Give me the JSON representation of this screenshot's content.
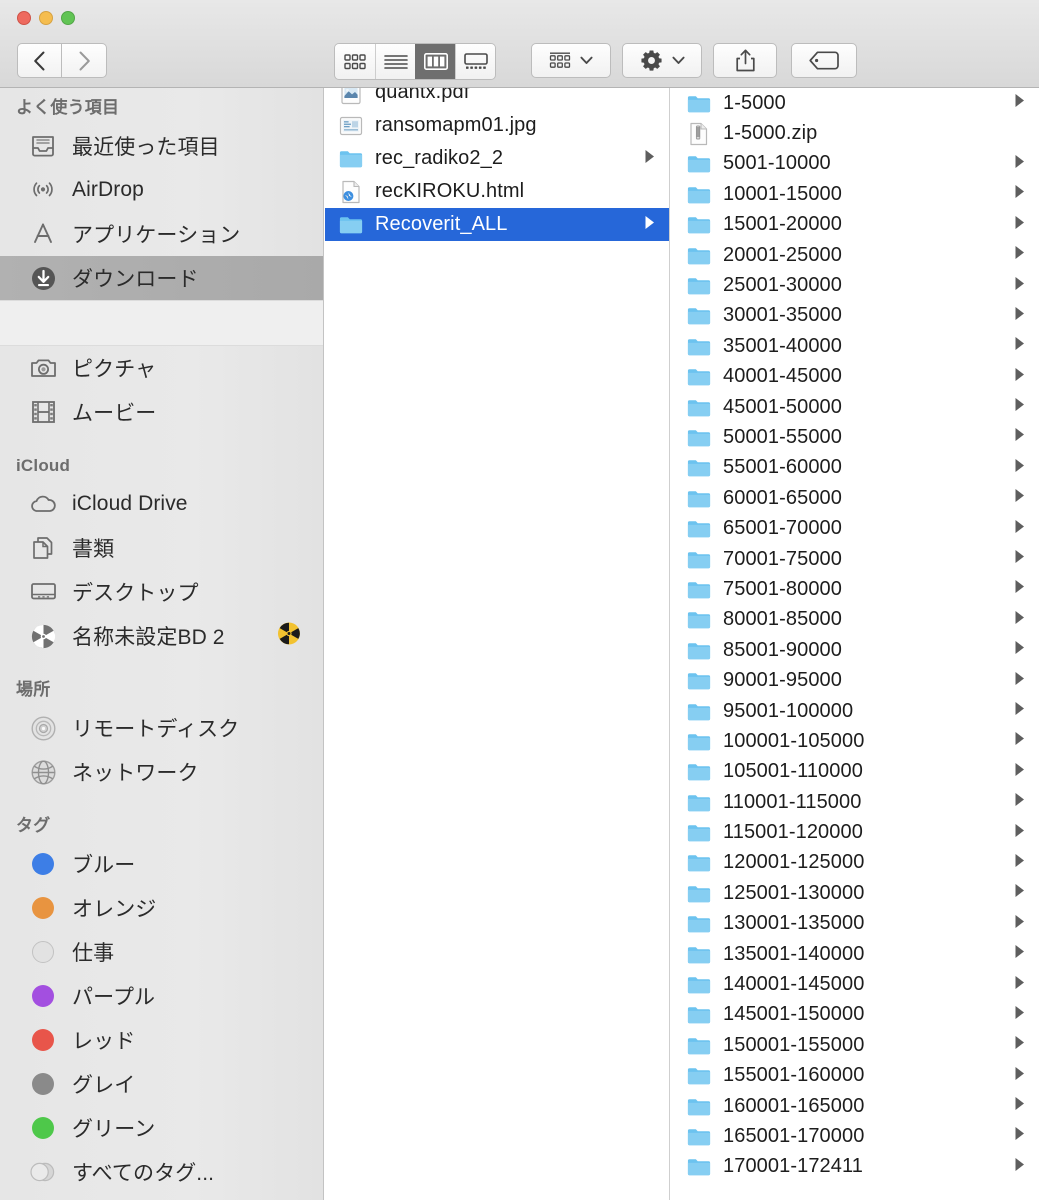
{
  "window": {
    "traffic_lights": [
      {
        "name": "close",
        "color": "#ee6a5f"
      },
      {
        "name": "minimize",
        "color": "#f5bd4f"
      },
      {
        "name": "zoom",
        "color": "#61c454"
      }
    ]
  },
  "toolbar": {
    "back_label": "戻る",
    "forward_label": "進む",
    "view_modes": [
      {
        "name": "icon-view",
        "label": "アイコン表示",
        "active": false
      },
      {
        "name": "list-view",
        "label": "リスト表示",
        "active": false
      },
      {
        "name": "column-view",
        "label": "カラム表示",
        "active": true
      },
      {
        "name": "gallery-view",
        "label": "ギャラリー表示",
        "active": false
      }
    ],
    "arrange_label": "グループ分け",
    "action_label": "操作",
    "share_label": "共有",
    "tags_label": "タグを編集"
  },
  "sidebar": {
    "sections": [
      {
        "name": "favorites",
        "header": "よく使う項目",
        "items": [
          {
            "label": "最近使った項目",
            "icon": "recents-icon",
            "selected": false
          },
          {
            "label": "AirDrop",
            "icon": "airdrop-icon",
            "selected": false
          },
          {
            "label": "アプリケーション",
            "icon": "applications-icon",
            "selected": false
          },
          {
            "label": "ダウンロード",
            "icon": "downloads-icon",
            "selected": true
          },
          {
            "label": "",
            "icon": "blank-icon",
            "selected": false,
            "blank": true
          },
          {
            "label": "ピクチャ",
            "icon": "pictures-icon",
            "selected": false
          },
          {
            "label": "ムービー",
            "icon": "movies-icon",
            "selected": false
          }
        ]
      },
      {
        "name": "icloud",
        "header": "iCloud",
        "items": [
          {
            "label": "iCloud Drive",
            "icon": "icloud-drive-icon",
            "selected": false
          },
          {
            "label": "書類",
            "icon": "documents-icon",
            "selected": false
          },
          {
            "label": "デスクトップ",
            "icon": "desktop-icon",
            "selected": false
          },
          {
            "label": "名称未設定BD 2",
            "icon": "optical-disc-icon",
            "selected": false,
            "trailing": "burn-icon"
          }
        ]
      },
      {
        "name": "locations",
        "header": "場所",
        "items": [
          {
            "label": "リモートディスク",
            "icon": "remote-disc-icon",
            "selected": false
          },
          {
            "label": "ネットワーク",
            "icon": "network-icon",
            "selected": false
          }
        ]
      },
      {
        "name": "tags",
        "header": "タグ",
        "items": [
          {
            "label": "ブルー",
            "icon": "tag-dot-icon",
            "color": "#3d7ee6",
            "selected": false
          },
          {
            "label": "オレンジ",
            "icon": "tag-dot-icon",
            "color": "#e89440",
            "selected": false
          },
          {
            "label": "仕事",
            "icon": "tag-dot-icon",
            "color": "#e2e2e2",
            "selected": false
          },
          {
            "label": "パープル",
            "icon": "tag-dot-icon",
            "color": "#a34fe0",
            "selected": false
          },
          {
            "label": "レッド",
            "icon": "tag-dot-icon",
            "color": "#e8554a",
            "selected": false
          },
          {
            "label": "グレイ",
            "icon": "tag-dot-icon",
            "color": "#8a8a8a",
            "selected": false
          },
          {
            "label": "グリーン",
            "icon": "tag-dot-icon",
            "color": "#4ec84a",
            "selected": false
          },
          {
            "label": "すべてのタグ...",
            "icon": "all-tags-icon",
            "color": "#d8d8d8",
            "selected": false
          }
        ]
      }
    ]
  },
  "columns": [
    {
      "name": "downloads-column",
      "items": [
        {
          "label": "quantx.pdf",
          "icon": "pdf-file-icon",
          "disclosure": false,
          "selected": false
        },
        {
          "label": "ransomapm01.jpg",
          "icon": "image-file-icon",
          "disclosure": false,
          "selected": false
        },
        {
          "label": "rec_radiko2_2",
          "icon": "folder-icon",
          "disclosure": true,
          "selected": false
        },
        {
          "label": "recKIROKU.html",
          "icon": "html-file-icon",
          "disclosure": false,
          "selected": false
        },
        {
          "label": "Recoverit_ALL",
          "icon": "folder-icon",
          "disclosure": true,
          "selected": true
        }
      ]
    },
    {
      "name": "recoverit-all-column",
      "items": [
        {
          "label": "1-5000",
          "icon": "folder-icon",
          "disclosure": true,
          "selected": false
        },
        {
          "label": "1-5000.zip",
          "icon": "zip-file-icon",
          "disclosure": false,
          "selected": false
        },
        {
          "label": "5001-10000",
          "icon": "folder-icon",
          "disclosure": true,
          "selected": false
        },
        {
          "label": "10001-15000",
          "icon": "folder-icon",
          "disclosure": true,
          "selected": false
        },
        {
          "label": "15001-20000",
          "icon": "folder-icon",
          "disclosure": true,
          "selected": false
        },
        {
          "label": "20001-25000",
          "icon": "folder-icon",
          "disclosure": true,
          "selected": false
        },
        {
          "label": "25001-30000",
          "icon": "folder-icon",
          "disclosure": true,
          "selected": false
        },
        {
          "label": "30001-35000",
          "icon": "folder-icon",
          "disclosure": true,
          "selected": false
        },
        {
          "label": "35001-40000",
          "icon": "folder-icon",
          "disclosure": true,
          "selected": false
        },
        {
          "label": "40001-45000",
          "icon": "folder-icon",
          "disclosure": true,
          "selected": false
        },
        {
          "label": "45001-50000",
          "icon": "folder-icon",
          "disclosure": true,
          "selected": false
        },
        {
          "label": "50001-55000",
          "icon": "folder-icon",
          "disclosure": true,
          "selected": false
        },
        {
          "label": "55001-60000",
          "icon": "folder-icon",
          "disclosure": true,
          "selected": false
        },
        {
          "label": "60001-65000",
          "icon": "folder-icon",
          "disclosure": true,
          "selected": false
        },
        {
          "label": "65001-70000",
          "icon": "folder-icon",
          "disclosure": true,
          "selected": false
        },
        {
          "label": "70001-75000",
          "icon": "folder-icon",
          "disclosure": true,
          "selected": false
        },
        {
          "label": "75001-80000",
          "icon": "folder-icon",
          "disclosure": true,
          "selected": false
        },
        {
          "label": "80001-85000",
          "icon": "folder-icon",
          "disclosure": true,
          "selected": false
        },
        {
          "label": "85001-90000",
          "icon": "folder-icon",
          "disclosure": true,
          "selected": false
        },
        {
          "label": "90001-95000",
          "icon": "folder-icon",
          "disclosure": true,
          "selected": false
        },
        {
          "label": "95001-100000",
          "icon": "folder-icon",
          "disclosure": true,
          "selected": false
        },
        {
          "label": "100001-105000",
          "icon": "folder-icon",
          "disclosure": true,
          "selected": false
        },
        {
          "label": "105001-110000",
          "icon": "folder-icon",
          "disclosure": true,
          "selected": false
        },
        {
          "label": "110001-115000",
          "icon": "folder-icon",
          "disclosure": true,
          "selected": false
        },
        {
          "label": "115001-120000",
          "icon": "folder-icon",
          "disclosure": true,
          "selected": false
        },
        {
          "label": "120001-125000",
          "icon": "folder-icon",
          "disclosure": true,
          "selected": false
        },
        {
          "label": "125001-130000",
          "icon": "folder-icon",
          "disclosure": true,
          "selected": false
        },
        {
          "label": "130001-135000",
          "icon": "folder-icon",
          "disclosure": true,
          "selected": false
        },
        {
          "label": "135001-140000",
          "icon": "folder-icon",
          "disclosure": true,
          "selected": false
        },
        {
          "label": "140001-145000",
          "icon": "folder-icon",
          "disclosure": true,
          "selected": false
        },
        {
          "label": "145001-150000",
          "icon": "folder-icon",
          "disclosure": true,
          "selected": false
        },
        {
          "label": "150001-155000",
          "icon": "folder-icon",
          "disclosure": true,
          "selected": false
        },
        {
          "label": "155001-160000",
          "icon": "folder-icon",
          "disclosure": true,
          "selected": false
        },
        {
          "label": "160001-165000",
          "icon": "folder-icon",
          "disclosure": true,
          "selected": false
        },
        {
          "label": "165001-170000",
          "icon": "folder-icon",
          "disclosure": true,
          "selected": false
        },
        {
          "label": "170001-172411",
          "icon": "folder-icon",
          "disclosure": true,
          "selected": false
        }
      ]
    }
  ],
  "colors": {
    "selection_blue": "#2667d9",
    "selection_gray": "#aeaeae",
    "folder_blue": "#79cdf5",
    "sidebar_bg": "#e8e8e8"
  }
}
